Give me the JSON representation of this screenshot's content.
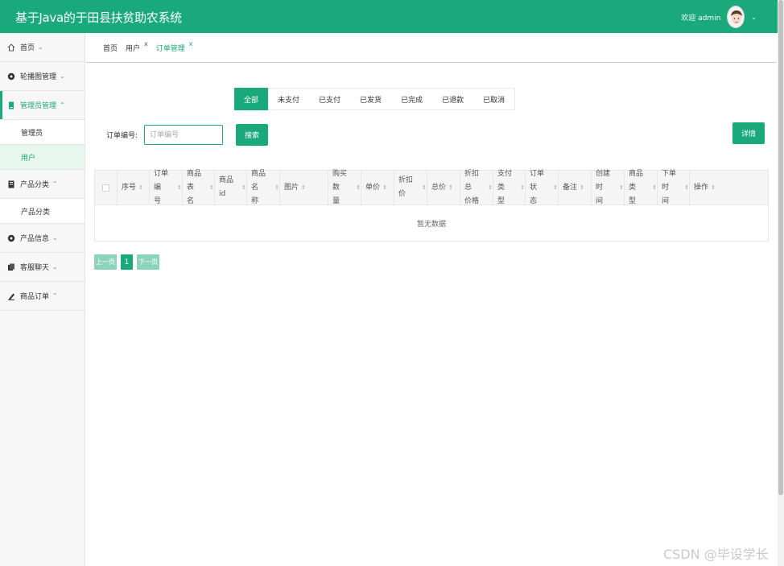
{
  "header": {
    "title": "基于Java的于田县扶贫助农系统",
    "welcome": "欢迎 admin",
    "caret": "⌄"
  },
  "sidebar": {
    "items": [
      {
        "label": "首页",
        "icon": "home-icon",
        "arrow": "⌄"
      },
      {
        "label": "轮播图管理",
        "icon": "carousel-icon",
        "arrow": "⌄"
      },
      {
        "label": "管理员管理",
        "icon": "admin-icon",
        "arrow": "⌃",
        "active": true,
        "children": [
          {
            "label": "管理员"
          },
          {
            "label": "用户",
            "active": true
          }
        ]
      },
      {
        "label": "产品分类",
        "icon": "category-icon",
        "arrow": "⌃",
        "children": [
          {
            "label": "产品分类"
          }
        ]
      },
      {
        "label": "产品信息",
        "icon": "product-icon",
        "arrow": "⌄"
      },
      {
        "label": "客服聊天",
        "icon": "chat-icon",
        "arrow": "⌄"
      },
      {
        "label": "商品订单",
        "icon": "order-icon",
        "arrow": "⌃"
      }
    ]
  },
  "breadcrumb": [
    {
      "label": "首页"
    },
    {
      "label": "用户",
      "close": "x"
    },
    {
      "label": "订单管理",
      "close": "x",
      "active": true
    }
  ],
  "status_tabs": [
    "全部",
    "未支付",
    "已支付",
    "已发货",
    "已完成",
    "已退款",
    "已取消"
  ],
  "active_status_tab": "全部",
  "search": {
    "label": "订单编号:",
    "placeholder": "订单编号",
    "button": "搜索"
  },
  "detail_button": "详情",
  "table": {
    "columns": [
      "序号",
      "订单编\n号",
      "商品表\n名",
      "商品id",
      "商品名\n称",
      "图片",
      "购买数\n量",
      "单价",
      "折扣价",
      "总价",
      "折扣总\n价格",
      "支付类\n型",
      "订单状\n态",
      "备注",
      "创建时\n间",
      "商品类\n型",
      "下单时\n间",
      "操作"
    ],
    "sort_glyph": "⇕",
    "empty_text": "暂无数据"
  },
  "pagination": {
    "prev": "上一页",
    "current": "1",
    "next": "下一页"
  },
  "watermark": "CSDN @毕设学长",
  "colors": {
    "primary": "#1aa97a",
    "light_primary": "#8cd3bb"
  }
}
